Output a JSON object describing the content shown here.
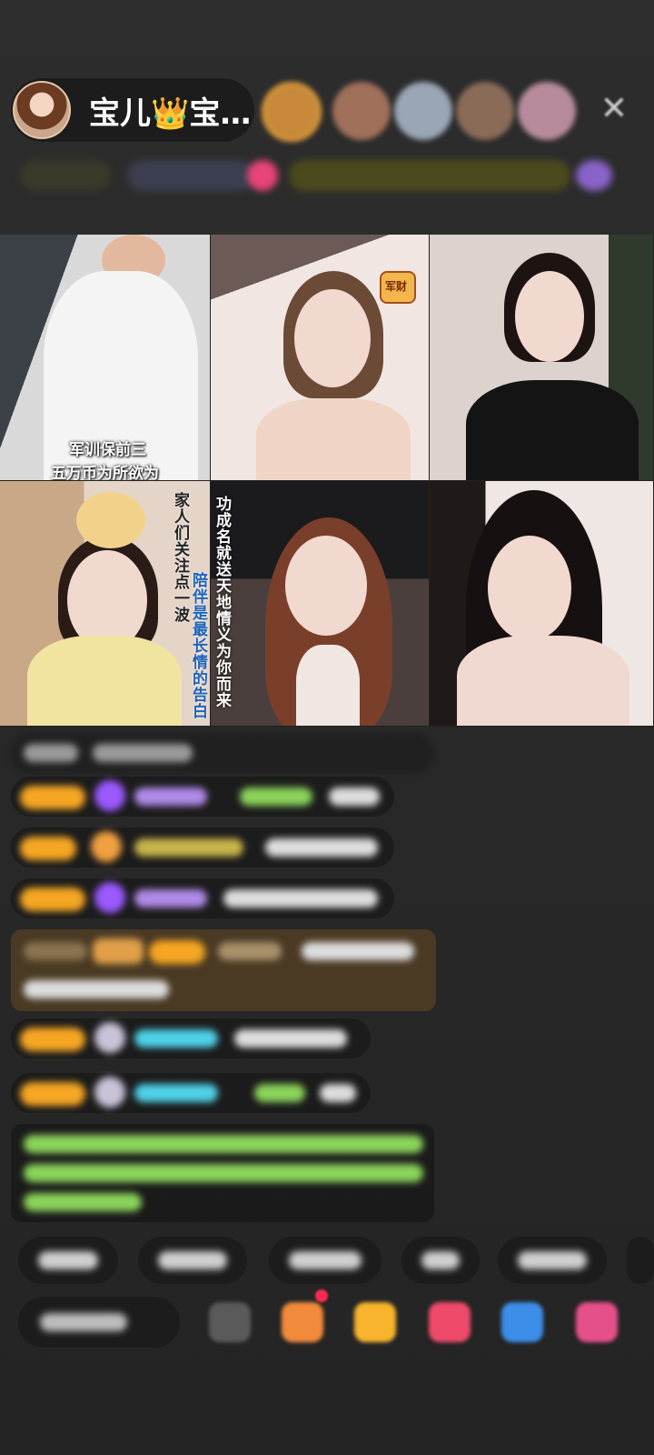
{
  "header": {
    "host_name": "宝儿👑宝…",
    "close_label": "✕"
  },
  "videos": {
    "cell1": {
      "line1": "军训保前三",
      "line2": "五万币为所欲为"
    },
    "cell2": {
      "badge": "军财"
    },
    "cell4": {
      "vertical_left": "家人们关注点一波",
      "vertical_blue": "陪伴是最长情的告白"
    },
    "cell5": {
      "vertical_text": "功成名就送天地情义为你而来"
    }
  },
  "colors": {
    "level_badge": "#f5a623",
    "gem_purple": "#9b59ff",
    "nick_green": "#8bd35a",
    "nick_cyan": "#4fd1e8",
    "chat_bg": "rgba(0,0,0,0.28)",
    "highlight_bg": "#4a3a24"
  }
}
